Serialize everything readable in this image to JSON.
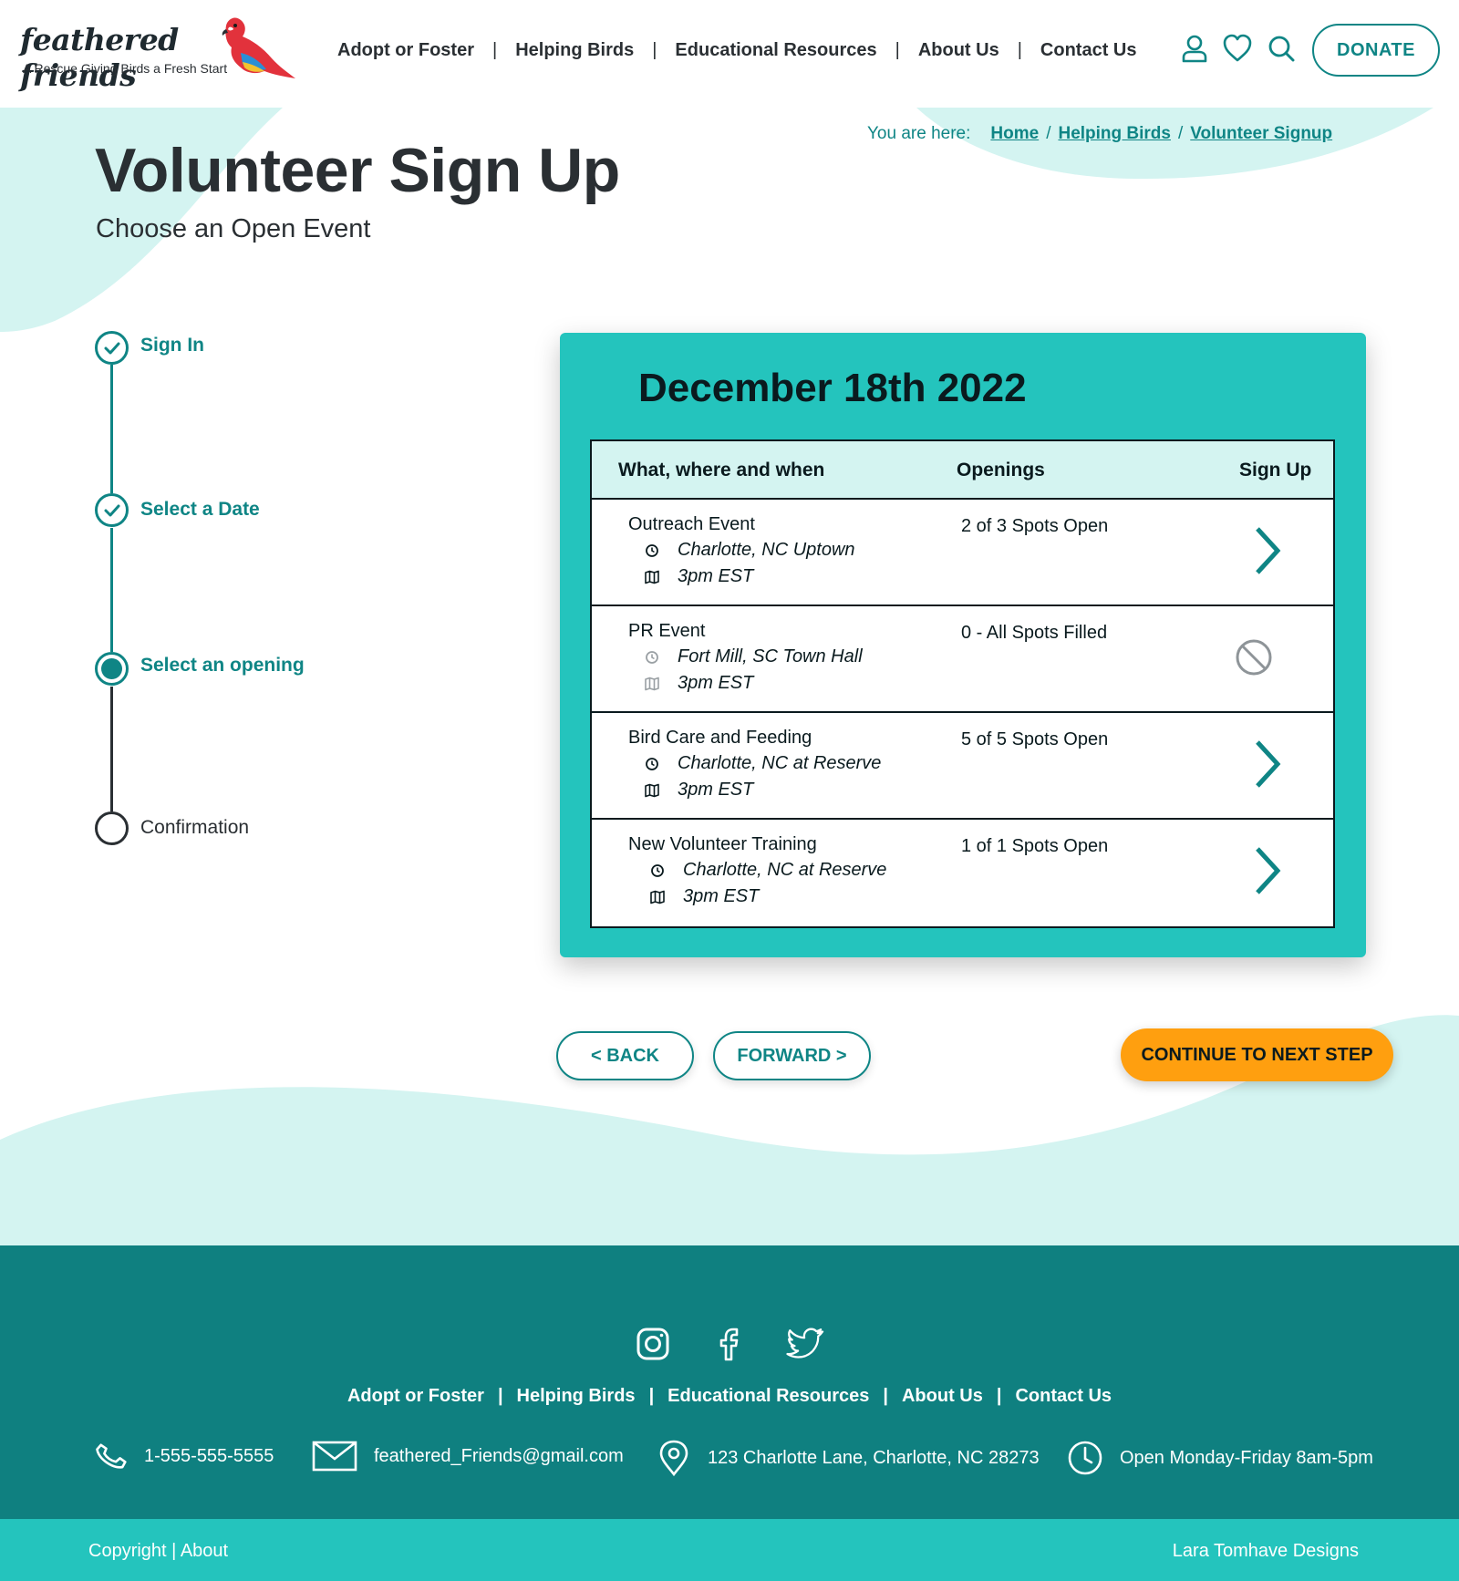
{
  "colors": {
    "teal_dark": "#0f8585",
    "teal_card": "#24c4bd",
    "teal_light": "#d4f4f1",
    "footer_teal": "#0f8080",
    "orange": "#ff9f0f",
    "text": "#2a2f33"
  },
  "brand": {
    "name": "feathered friends",
    "tagline": "A Rescue Giving Birds a Fresh Start",
    "logo_icon": "parrot-logo"
  },
  "nav": {
    "items": [
      {
        "label": "Adopt or Foster"
      },
      {
        "label": "Helping Birds"
      },
      {
        "label": "Educational Resources"
      },
      {
        "label": "About Us"
      },
      {
        "label": "Contact Us"
      }
    ],
    "separator": "|",
    "icons": [
      "user-icon",
      "heart-icon",
      "search-icon"
    ],
    "donate_label": "DONATE"
  },
  "breadcrumb": {
    "prefix": "You are here:",
    "separator": "/",
    "items": [
      {
        "label": "Home"
      },
      {
        "label": "Helping Birds"
      },
      {
        "label": "Volunteer Signup"
      }
    ]
  },
  "page": {
    "title": "Volunteer Sign Up",
    "subtitle": "Choose an Open Event"
  },
  "steps": [
    {
      "label": "Sign In",
      "status": "complete"
    },
    {
      "label": "Select a Date",
      "status": "complete"
    },
    {
      "label": "Select an opening",
      "status": "current"
    },
    {
      "label": "Confirmation",
      "status": "pending"
    }
  ],
  "events": {
    "date": "December 18th 2022",
    "columns": {
      "what": "What, where and when",
      "openings": "Openings",
      "signup": "Sign Up"
    },
    "rows": [
      {
        "name": "Outreach Event",
        "location": "Charlotte, NC Uptown",
        "time": "3pm EST",
        "openings": "2 of 3 Spots Open",
        "available": true
      },
      {
        "name": "PR Event",
        "location": "Fort Mill, SC Town Hall",
        "time": "3pm EST",
        "openings": "0 - All Spots Filled",
        "available": false
      },
      {
        "name": "Bird Care and Feeding",
        "location": "Charlotte, NC at Reserve",
        "time": "3pm EST",
        "openings": "5 of 5 Spots Open",
        "available": true
      },
      {
        "name": "New Volunteer Training",
        "location": "Charlotte, NC at Reserve",
        "time": "3pm EST",
        "openings": "1 of 1 Spots Open",
        "available": true
      }
    ]
  },
  "actions": {
    "back": "< BACK",
    "forward": "FORWARD >",
    "continue": "CONTINUE TO NEXT STEP"
  },
  "footer": {
    "socials": [
      "instagram-icon",
      "facebook-icon",
      "twitter-icon"
    ],
    "nav": [
      {
        "label": "Adopt or Foster"
      },
      {
        "label": "Helping Birds"
      },
      {
        "label": "Educational Resources"
      },
      {
        "label": "About Us"
      },
      {
        "label": "Contact Us"
      }
    ],
    "separator": "|",
    "phone": "1-555-555-5555",
    "email": "feathered_Friends@gmail.com",
    "address": "123 Charlotte Lane, Charlotte, NC 28273",
    "hours": "Open Monday-Friday 8am-5pm",
    "copyright": "Copyright",
    "about": "About",
    "credit": "Lara Tomhave Designs"
  }
}
